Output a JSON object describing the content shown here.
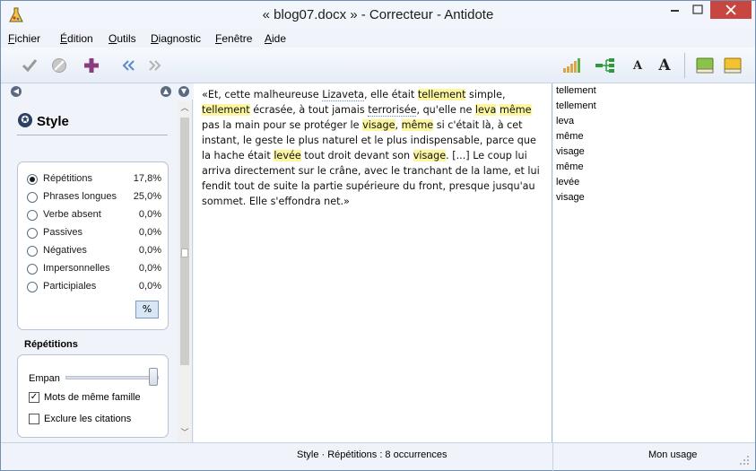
{
  "window": {
    "title": "« blog07.docx » - Correcteur - Antidote",
    "minimize_glyph": "—",
    "maximize_glyph": "☐",
    "close_glyph": "✕"
  },
  "menu": {
    "items": [
      "Fichier",
      "Édition",
      "Outils",
      "Diagnostic",
      "Fenêtre",
      "Aide"
    ]
  },
  "toolbar": {
    "icons": [
      "check-icon",
      "cancel-icon",
      "plus-icon",
      "previous-icon",
      "next-icon",
      "chart-icon",
      "tree-icon",
      "text-small-icon",
      "text-large-icon",
      "book-green-icon",
      "book-yellow-icon"
    ],
    "text_small": "A",
    "text_large": "A"
  },
  "left_panel": {
    "style_title": "Style",
    "style_icon": "✪",
    "radio_options": [
      {
        "label": "Répétitions",
        "value": "17,8%",
        "selected": true
      },
      {
        "label": "Phrases longues",
        "value": "25,0%",
        "selected": false
      },
      {
        "label": "Verbe absent",
        "value": "0,0%",
        "selected": false
      },
      {
        "label": "Passives",
        "value": "0,0%",
        "selected": false
      },
      {
        "label": "Négatives",
        "value": "0,0%",
        "selected": false
      },
      {
        "label": "Impersonnelles",
        "value": "0,0%",
        "selected": false
      },
      {
        "label": "Participiales",
        "value": "0,0%",
        "selected": false
      }
    ],
    "percent_button": "%",
    "section_label": "Répétitions",
    "empan_label": "Empan",
    "empan_level": 1.0,
    "checkboxes": [
      {
        "label": "Mots de même famille",
        "checked": true
      },
      {
        "label": "Exclure les citations",
        "checked": false
      }
    ]
  },
  "text": {
    "segments": [
      {
        "t": "«Et, cette malheureuse "
      },
      {
        "t": "Lizaveta",
        "u": true
      },
      {
        "t": ", elle était "
      },
      {
        "t": "tellement",
        "h": true
      },
      {
        "t": " simple, "
      },
      {
        "t": "tellement",
        "h": true
      },
      {
        "t": " écrasée, à tout jamais "
      },
      {
        "t": "terrorisée",
        "u": true
      },
      {
        "t": ", qu'elle ne "
      },
      {
        "t": "leva",
        "h": true
      },
      {
        "t": " "
      },
      {
        "t": "même",
        "h": true
      },
      {
        "t": " pas la main pour se protéger le "
      },
      {
        "t": "visage",
        "h": true
      },
      {
        "t": ", "
      },
      {
        "t": "même",
        "h": true
      },
      {
        "t": " si c'était là, à cet instant, le geste le plus naturel et le plus indispensable, parce que la hache était "
      },
      {
        "t": "levée",
        "h": true
      },
      {
        "t": " tout droit devant son "
      },
      {
        "t": "visage",
        "h": true
      },
      {
        "t": ". [...] Le coup lui arriva directement sur le crâne, avec le tranchant de la lame, et lui fendit tout de suite la partie supérieure du front, presque jusqu'au sommet. Elle s'effondra net.»"
      }
    ]
  },
  "word_list": [
    "tellement",
    "tellement",
    "leva",
    "même",
    "visage",
    "même",
    "levée",
    "visage"
  ],
  "status": {
    "main": "Style · Répétitions : 8 occurrences",
    "right": "Mon usage"
  },
  "colors": {
    "highlight": "#fcf69f",
    "close_button": "#c7463f",
    "accent": "#2b3f63"
  }
}
